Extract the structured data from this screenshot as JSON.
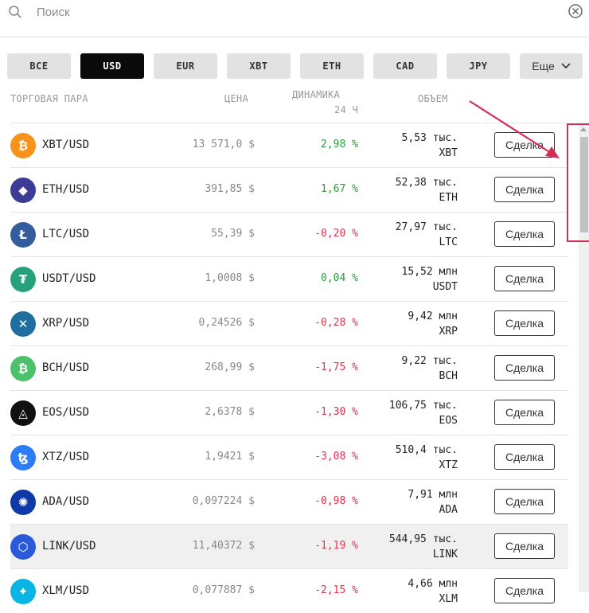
{
  "search": {
    "placeholder": "Поиск"
  },
  "tabs": [
    {
      "label": "ВСЕ",
      "active": false
    },
    {
      "label": "USD",
      "active": true
    },
    {
      "label": "EUR",
      "active": false
    },
    {
      "label": "XBT",
      "active": false
    },
    {
      "label": "ETH",
      "active": false
    },
    {
      "label": "CAD",
      "active": false
    },
    {
      "label": "JPY",
      "active": false
    },
    {
      "label": "Еще",
      "active": false
    }
  ],
  "headers": {
    "pair": "ТОРГОВАЯ ПАРА",
    "price": "ЦЕНА",
    "change_line1": "ДИНАМИКА",
    "change_line2": "24 Ч",
    "volume": "ОБЪЕМ"
  },
  "trade_label": "Сделка",
  "rows": [
    {
      "pair": "XBT/USD",
      "price": "13 571,0 $",
      "change": "2,98 %",
      "direction": "up",
      "vol1": "5,53 тыс.",
      "vol2": "XBT",
      "icon": "bitcoin-icon",
      "color": "#f7931a",
      "glyph": "₿"
    },
    {
      "pair": "ETH/USD",
      "price": "391,85 $",
      "change": "1,67 %",
      "direction": "up",
      "vol1": "52,38 тыс.",
      "vol2": "ETH",
      "icon": "ethereum-icon",
      "color": "#3c3c96",
      "glyph": "◆"
    },
    {
      "pair": "LTC/USD",
      "price": "55,39 $",
      "change": "-0,20 %",
      "direction": "down",
      "vol1": "27,97 тыс.",
      "vol2": "LTC",
      "icon": "litecoin-icon",
      "color": "#345d9d",
      "glyph": "Ł"
    },
    {
      "pair": "USDT/USD",
      "price": "1,0008 $",
      "change": "0,04 %",
      "direction": "up",
      "vol1": "15,52 млн",
      "vol2": "USDT",
      "icon": "tether-icon",
      "color": "#26a17b",
      "glyph": "₮"
    },
    {
      "pair": "XRP/USD",
      "price": "0,24526 $",
      "change": "-0,28 %",
      "direction": "down",
      "vol1": "9,42 млн",
      "vol2": "XRP",
      "icon": "ripple-icon",
      "color": "#1e6fa0",
      "glyph": "✕"
    },
    {
      "pair": "BCH/USD",
      "price": "268,99 $",
      "change": "-1,75 %",
      "direction": "down",
      "vol1": "9,22 тыс.",
      "vol2": "BCH",
      "icon": "bitcoin-cash-icon",
      "color": "#4cc06a",
      "glyph": "₿"
    },
    {
      "pair": "EOS/USD",
      "price": "2,6378 $",
      "change": "-1,30 %",
      "direction": "down",
      "vol1": "106,75 тыс.",
      "vol2": "EOS",
      "icon": "eos-icon",
      "color": "#111111",
      "glyph": "◬"
    },
    {
      "pair": "XTZ/USD",
      "price": "1,9421 $",
      "change": "-3,08 %",
      "direction": "down",
      "vol1": "510,4 тыс.",
      "vol2": "XTZ",
      "icon": "tezos-icon",
      "color": "#2c7df7",
      "glyph": "ꜩ"
    },
    {
      "pair": "ADA/USD",
      "price": "0,097224 $",
      "change": "-0,98 %",
      "direction": "down",
      "vol1": "7,91 млн",
      "vol2": "ADA",
      "icon": "cardano-icon",
      "color": "#0d3aa8",
      "glyph": "✺"
    },
    {
      "pair": "LINK/USD",
      "price": "11,40372 $",
      "change": "-1,19 %",
      "direction": "down",
      "vol1": "544,95 тыс.",
      "vol2": "LINK",
      "icon": "chainlink-icon",
      "color": "#2a5ada",
      "glyph": "⬡",
      "highlight": true
    },
    {
      "pair": "XLM/USD",
      "price": "0,077887 $",
      "change": "-2,15 %",
      "direction": "down",
      "vol1": "4,66 млн",
      "vol2": "XLM",
      "icon": "stellar-icon",
      "color": "#08b5e5",
      "glyph": "✦"
    }
  ]
}
